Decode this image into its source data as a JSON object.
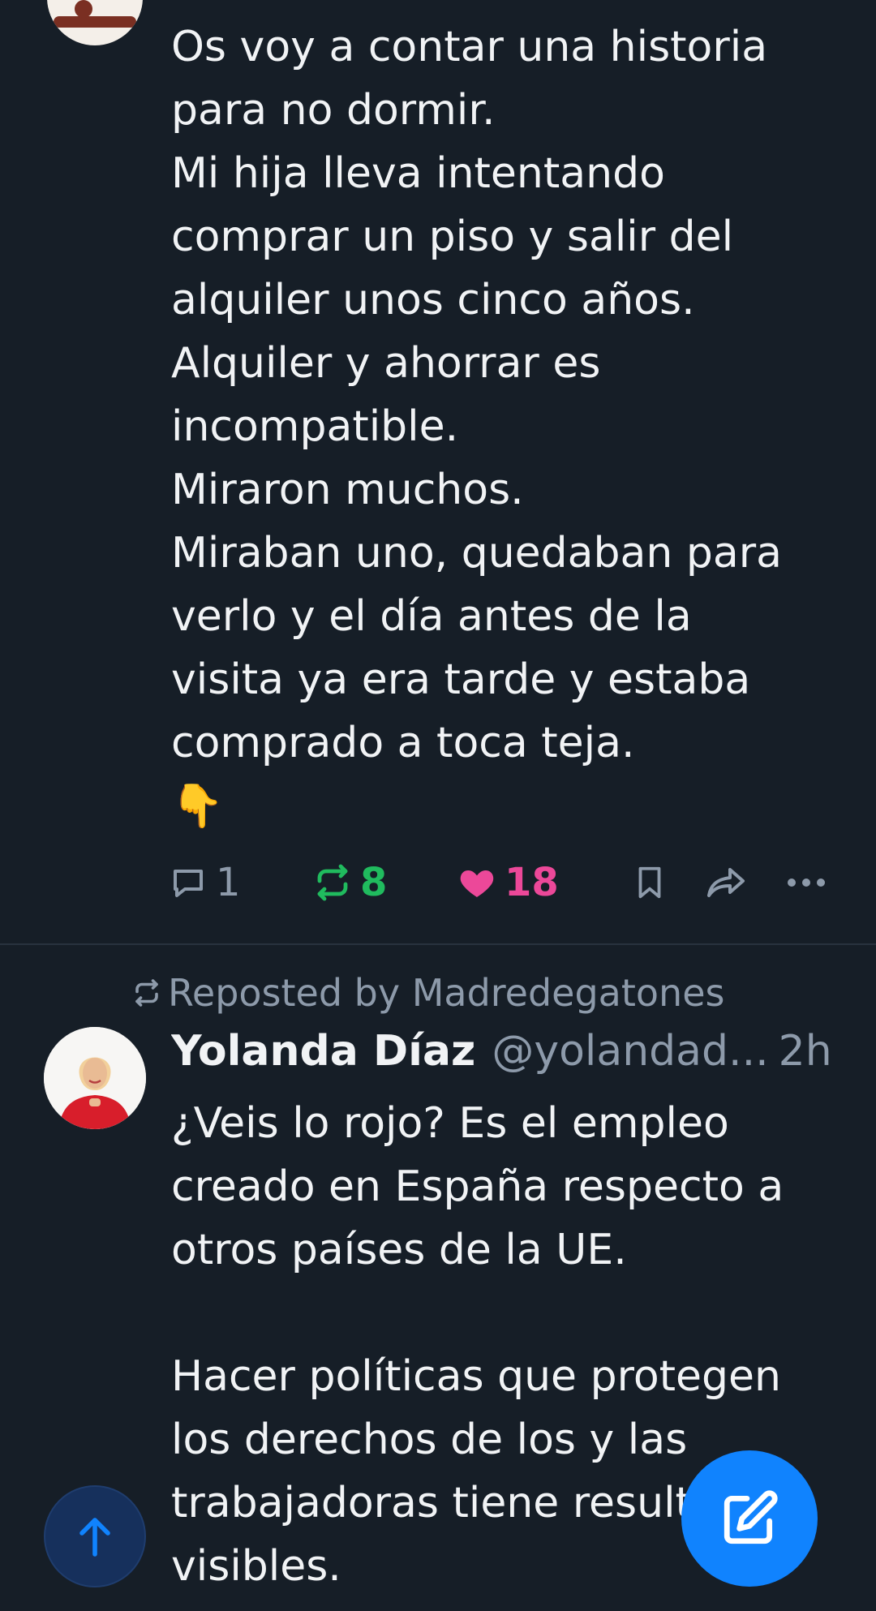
{
  "colors": {
    "background": "#161e27",
    "text": "#f1f3f5",
    "muted": "#8d9aaa",
    "repost_green": "#20bb5e",
    "like_pink": "#ec4899",
    "accent_blue": "#1083fe",
    "divider": "#28323e"
  },
  "posts": [
    {
      "text": "Os voy a contar una historia\npara no dormir.\nMi hija lleva intentando\ncomprar un piso y salir del\nalquiler unos cinco años.\nAlquiler y ahorrar es\nincompatible.\nMiraron muchos.\nMiraban uno, quedaban para\nverlo y el día antes de la\nvisita ya era tarde y estaba\ncomprado a toca teja.\n👇",
      "replies": "1",
      "reposts": "8",
      "likes": "18",
      "icons": {
        "reply": "reply-icon",
        "repost": "repost-icon",
        "like": "heart-icon",
        "bookmark": "bookmark-icon",
        "share": "share-icon",
        "more": "more-icon"
      }
    },
    {
      "reposted_by": "Reposted by Madredegatones",
      "author": {
        "display_name": "Yolanda Díaz",
        "handle": "@yolandad...",
        "timestamp": "2h"
      },
      "text": "¿Veis lo rojo? Es el empleo\ncreado en España respecto a\notros países de la UE.\n\nHacer políticas que protegen\nlos derechos de los y las\ntrabajadoras tiene resultados\nvisibles."
    }
  ],
  "floating": {
    "scroll_top_icon": "arrow-up-icon",
    "compose_icon": "compose-icon"
  }
}
